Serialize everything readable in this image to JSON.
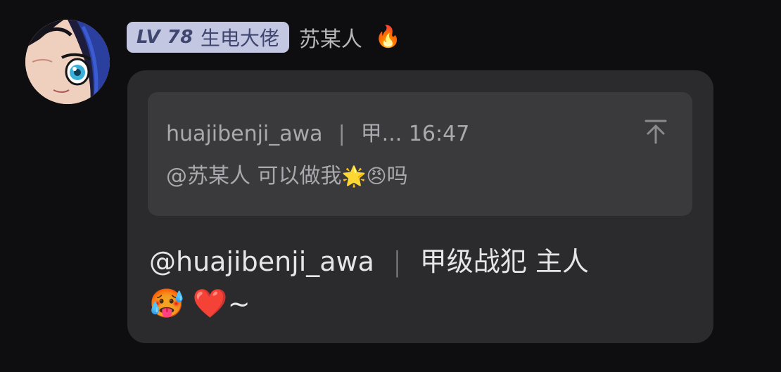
{
  "sender": {
    "level_prefix": "LV",
    "level_number": "78",
    "title": "生电大佬",
    "username": "苏某人",
    "flame_emoji": "🔥"
  },
  "quote": {
    "author": "huajibenji_awa",
    "separator": "|",
    "author_title": "甲...",
    "time": "16:47",
    "mention": "@苏某人",
    "text": "可以做我",
    "emojis": [
      "🌟",
      "😠"
    ],
    "suffix": "吗"
  },
  "message": {
    "mention": "@huajibenji_awa",
    "separator": "|",
    "title": "甲级战犯",
    "text": "主人",
    "emojis": [
      "🥵",
      "❤️"
    ],
    "tail": "~"
  },
  "colors": {
    "background": "#0e0e10",
    "bubble": "#2b2b2e",
    "quote_box": "#3a3a3d",
    "level_badge_bg": "#c3c7e2",
    "level_badge_text": "#3f4770"
  },
  "icons": {
    "scroll_to_top": "arrow-up-to-line-icon"
  }
}
